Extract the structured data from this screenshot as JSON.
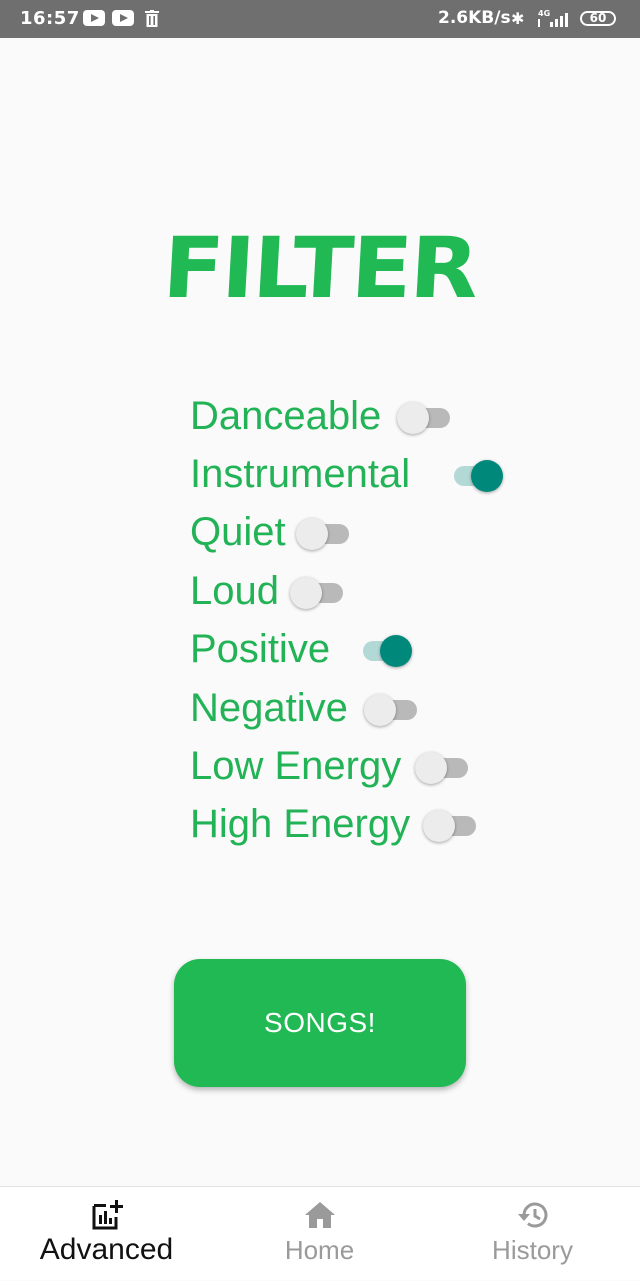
{
  "status_bar": {
    "time": "16:57",
    "net_speed": "2.6KB/s",
    "network_type": "4G",
    "battery": "60"
  },
  "title": "FILTER",
  "filters": [
    {
      "label": "Danceable",
      "enabled": false
    },
    {
      "label": "Instrumental",
      "enabled": true
    },
    {
      "label": "Quiet",
      "enabled": false
    },
    {
      "label": "Loud",
      "enabled": false
    },
    {
      "label": "Positive",
      "enabled": true
    },
    {
      "label": "Negative",
      "enabled": false
    },
    {
      "label": "Low Energy",
      "enabled": false
    },
    {
      "label": "High Energy",
      "enabled": false
    }
  ],
  "songs_button": "SONGS!",
  "bottom_nav": {
    "items": [
      {
        "label": "Advanced",
        "icon": "chart-add-icon",
        "active": true
      },
      {
        "label": "Home",
        "icon": "home-icon",
        "active": false
      },
      {
        "label": "History",
        "icon": "history-icon",
        "active": false
      }
    ]
  },
  "colors": {
    "accent_green": "#20b954",
    "switch_on": "#00897b",
    "switch_on_track": "#b3d9d6",
    "switch_off_thumb": "#ececec",
    "switch_off_track": "#b9b9b9"
  }
}
